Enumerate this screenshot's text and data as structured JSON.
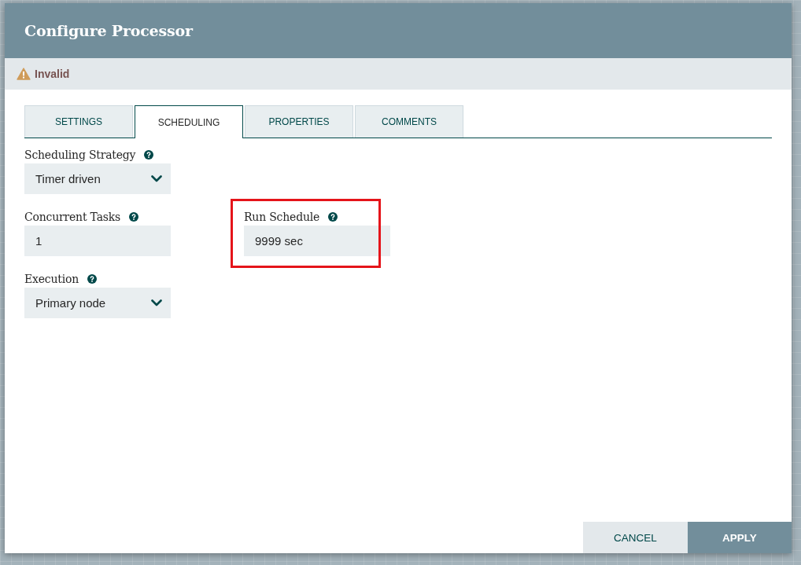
{
  "dialog": {
    "title": "Configure Processor"
  },
  "status": {
    "kind": "warning",
    "text": "Invalid"
  },
  "tabs": [
    {
      "label": "SETTINGS",
      "selected": false
    },
    {
      "label": "SCHEDULING",
      "selected": true
    },
    {
      "label": "PROPERTIES",
      "selected": false
    },
    {
      "label": "COMMENTS",
      "selected": false
    }
  ],
  "rows": [
    {
      "fields": [
        {
          "kind": "select",
          "label": "Scheduling Strategy",
          "value": "Timer driven",
          "highlighted": false
        }
      ]
    },
    {
      "fields": [
        {
          "kind": "input",
          "label": "Concurrent Tasks",
          "value": "1",
          "highlighted": false
        },
        {
          "kind": "input",
          "label": "Run Schedule",
          "value": "9999 sec",
          "highlighted": true
        }
      ]
    },
    {
      "fields": [
        {
          "kind": "select",
          "label": "Execution",
          "value": "Primary node",
          "highlighted": false
        }
      ]
    }
  ],
  "buttons": [
    {
      "kind": "secondary",
      "label": "CANCEL"
    },
    {
      "kind": "primary",
      "label": "APPLY"
    }
  ]
}
